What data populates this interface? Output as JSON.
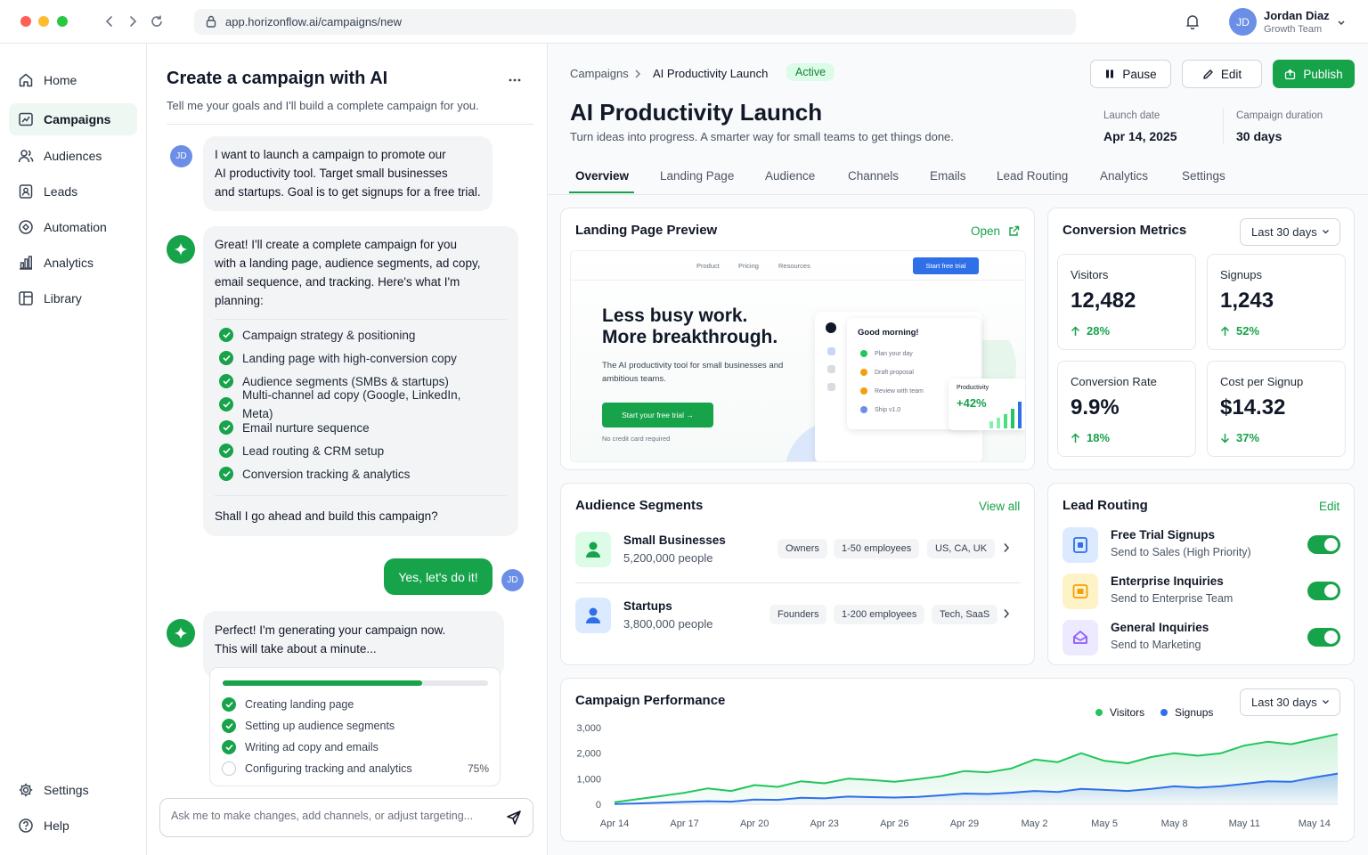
{
  "browser": {
    "url": "app.horizonflow.ai/campaigns/new"
  },
  "user": {
    "initials": "JD",
    "name": "Jordan Diaz",
    "team": "Growth Team"
  },
  "sidebar": {
    "items": [
      {
        "label": "Home",
        "icon": "home-icon"
      },
      {
        "label": "Campaigns",
        "icon": "campaigns-icon",
        "active": true
      },
      {
        "label": "Audiences",
        "icon": "audiences-icon"
      },
      {
        "label": "Leads",
        "icon": "leads-icon"
      },
      {
        "label": "Automation",
        "icon": "automation-icon"
      },
      {
        "label": "Analytics",
        "icon": "analytics-icon"
      },
      {
        "label": "Library",
        "icon": "library-icon"
      }
    ],
    "bottom": [
      {
        "label": "Settings",
        "icon": "gear-icon"
      },
      {
        "label": "Help",
        "icon": "help-icon"
      }
    ]
  },
  "chat": {
    "title": "Create a campaign with AI",
    "subtitle": "Tell me your goals and I'll build a complete campaign for you.",
    "user_message": [
      "I want to launch a campaign to promote our",
      "AI productivity tool. Target small businesses",
      "and startups. Goal is to get signups for a free trial."
    ],
    "ai_message_1": [
      "Great! I'll create a complete campaign for you",
      "with a landing page, audience segments, ad copy,",
      "email sequence, and tracking. Here's what I'm",
      "planning:"
    ],
    "plan_items": [
      "Campaign strategy & positioning",
      "Landing page with high-conversion copy",
      "Audience segments (SMBs & startups)",
      "Multi-channel ad copy (Google, LinkedIn, Meta)",
      "Email nurture sequence",
      "Lead routing & CRM setup",
      "Conversion tracking & analytics"
    ],
    "ai_question": "Shall I go ahead and build this campaign?",
    "reply_button": "Yes, let's do it!",
    "ai_message_2": [
      "Perfect! I'm generating your campaign now.",
      "This will take about a minute..."
    ],
    "progress": {
      "fraction": 0.75,
      "percent_label": "75%",
      "steps": [
        {
          "label": "Creating landing page",
          "done": true
        },
        {
          "label": "Setting up audience segments",
          "done": true
        },
        {
          "label": "Writing ad copy and emails",
          "done": true
        },
        {
          "label": "Configuring tracking and analytics",
          "done": false
        }
      ]
    },
    "input_placeholder": "Ask me to make changes, add channels, or adjust targeting..."
  },
  "campaign": {
    "breadcrumb_root": "Campaigns",
    "breadcrumb_current": "AI Productivity Launch",
    "status": "Active",
    "actions": {
      "pause": "Pause",
      "edit": "Edit",
      "publish": "Publish"
    },
    "title": "AI Productivity Launch",
    "subtitle": "Turn ideas into progress. A smarter way for small teams to get things done.",
    "launch_label": "Launch date",
    "launch_value": "Apr 14, 2025",
    "duration_label": "Campaign duration",
    "duration_value": "30 days",
    "tabs": [
      "Overview",
      "Landing Page",
      "Audience",
      "Channels",
      "Emails",
      "Lead Routing",
      "Analytics",
      "Settings"
    ]
  },
  "landing_preview": {
    "title": "Landing Page Preview",
    "open_label": "Open",
    "nav": [
      "Product",
      "Pricing",
      "Resources"
    ],
    "nav_cta": "Start free trial",
    "headline_1": "Less busy work.",
    "headline_2": "More breakthrough.",
    "description": "The AI productivity tool for small businesses and ambitious teams.",
    "cta": "Start your free trial →",
    "note": "No credit card required",
    "app_card_title": "Good morning!",
    "app_tasks": [
      "Plan your day",
      "Draft proposal",
      "Review with team",
      "Ship v1.0"
    ],
    "prod_label": "Productivity",
    "prod_value": "+42%"
  },
  "metrics": {
    "title": "Conversion Metrics",
    "range": "Last 30 days",
    "cards": [
      {
        "label": "Visitors",
        "value": "12,482",
        "delta": "28%",
        "dir": "up"
      },
      {
        "label": "Signups",
        "value": "1,243",
        "delta": "52%",
        "dir": "up"
      },
      {
        "label": "Conversion Rate",
        "value": "9.9%",
        "delta": "18%",
        "dir": "up"
      },
      {
        "label": "Cost per Signup",
        "value": "$14.32",
        "delta": "37%",
        "dir": "down"
      }
    ]
  },
  "audiences": {
    "title": "Audience Segments",
    "view_all": "View all",
    "segments": [
      {
        "name": "Small Businesses",
        "count": "5,200,000 people",
        "chips": [
          "Owners",
          "1-50 employees",
          "US, CA, UK"
        ]
      },
      {
        "name": "Startups",
        "count": "3,800,000 people",
        "chips": [
          "Founders",
          "1-200 employees",
          "Tech, SaaS"
        ]
      }
    ]
  },
  "lead_routing": {
    "title": "Lead Routing",
    "edit": "Edit",
    "rules": [
      {
        "name": "Free Trial Signups",
        "dest": "Send to Sales (High Priority)",
        "color": "#2f6fe8"
      },
      {
        "name": "Enterprise Inquiries",
        "dest": "Send to Enterprise Team",
        "color": "#f59e0b"
      },
      {
        "name": "General Inquiries",
        "dest": "Send to Marketing",
        "color": "#8b5cf6"
      }
    ]
  },
  "performance": {
    "title": "Campaign Performance",
    "range": "Last 30 days"
  },
  "chart_data": {
    "type": "area",
    "title": "Campaign Performance",
    "xlabel": "",
    "ylabel": "",
    "x": [
      "Apr 14",
      "Apr 15",
      "Apr 16",
      "Apr 17",
      "Apr 18",
      "Apr 19",
      "Apr 20",
      "Apr 21",
      "Apr 22",
      "Apr 23",
      "Apr 24",
      "Apr 25",
      "Apr 26",
      "Apr 27",
      "Apr 28",
      "Apr 29",
      "Apr 30",
      "May 1",
      "May 2",
      "May 3",
      "May 4",
      "May 5",
      "May 6",
      "May 7",
      "May 8",
      "May 9",
      "May 10",
      "May 11",
      "May 12",
      "May 13",
      "May 14",
      "May 15"
    ],
    "xticks": [
      "Apr 14",
      "Apr 17",
      "Apr 20",
      "Apr 23",
      "Apr 26",
      "Apr 29",
      "May 2",
      "May 5",
      "May 8",
      "May 11",
      "May 14"
    ],
    "yticks": [
      "0",
      "1,000",
      "2,000",
      "3,000"
    ],
    "ylim": [
      0,
      3000
    ],
    "series": [
      {
        "name": "Visitors",
        "color": "#22c55e",
        "values": [
          80,
          200,
          320,
          450,
          620,
          520,
          750,
          680,
          900,
          820,
          1000,
          950,
          880,
          980,
          1100,
          1300,
          1250,
          1400,
          1750,
          1650,
          2000,
          1700,
          1600,
          1850,
          2000,
          1900,
          2000,
          2300,
          2450,
          2350,
          2550,
          2750
        ]
      },
      {
        "name": "Signups",
        "color": "#2f6fe8",
        "values": [
          10,
          30,
          60,
          90,
          120,
          100,
          180,
          170,
          250,
          230,
          300,
          280,
          260,
          290,
          350,
          420,
          400,
          450,
          520,
          480,
          600,
          560,
          520,
          600,
          700,
          650,
          700,
          800,
          900,
          880,
          1050,
          1200
        ]
      }
    ],
    "grid": false,
    "legend": "top-right"
  },
  "colors": {
    "brand": "#16a34a",
    "accent_blue": "#2f6fe8"
  }
}
